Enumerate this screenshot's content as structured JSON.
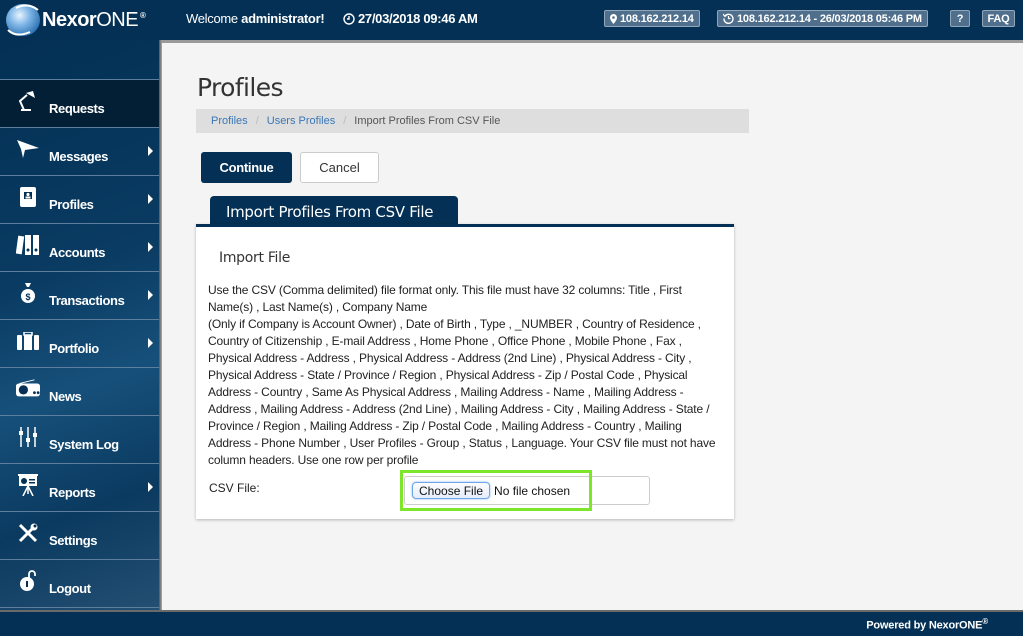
{
  "header": {
    "brand_bold": "Nexor",
    "brand_thin": "ONE",
    "brand_mark": "®",
    "welcome_prefix": "Welcome ",
    "welcome_user": "administrator!",
    "current_datetime": "27/03/2018 09:46 AM",
    "ip_address": "108.162.212.14",
    "last_login": "108.162.212.14 - 26/03/2018 05:46 PM",
    "help_label": "?",
    "faq_label": "FAQ"
  },
  "sidebar": {
    "items": [
      {
        "label": "Requests",
        "icon": "desk-lamp-icon",
        "active": true,
        "has_submenu": false
      },
      {
        "label": "Messages",
        "icon": "paper-plane-icon",
        "active": false,
        "has_submenu": true
      },
      {
        "label": "Profiles",
        "icon": "address-book-icon",
        "active": false,
        "has_submenu": true
      },
      {
        "label": "Accounts",
        "icon": "binders-icon",
        "active": false,
        "has_submenu": true
      },
      {
        "label": "Transactions",
        "icon": "money-bag-icon",
        "active": false,
        "has_submenu": true
      },
      {
        "label": "Portfolio",
        "icon": "briefcase-icon",
        "active": false,
        "has_submenu": true
      },
      {
        "label": "News",
        "icon": "radio-icon",
        "active": false,
        "has_submenu": false
      },
      {
        "label": "System Log",
        "icon": "sliders-icon",
        "active": false,
        "has_submenu": false
      },
      {
        "label": "Reports",
        "icon": "presentation-board-icon",
        "active": false,
        "has_submenu": true
      },
      {
        "label": "Settings",
        "icon": "tools-icon",
        "active": false,
        "has_submenu": false
      },
      {
        "label": "Logout",
        "icon": "unlocked-padlock-icon",
        "active": false,
        "has_submenu": false
      }
    ]
  },
  "main": {
    "page_title": "Profiles",
    "breadcrumb": [
      {
        "label": "Profiles",
        "link": true
      },
      {
        "label": "Users Profiles",
        "link": true
      },
      {
        "label": "Import Profiles From CSV File",
        "link": false
      }
    ],
    "continue_label": "Continue",
    "cancel_label": "Cancel",
    "panel_tab": "Import Profiles From CSV File",
    "panel_heading": "Import File",
    "description_line1": "Use the CSV (Comma delimited) file format only. This file must have 32 columns: Title , First Name(s) , Last Name(s) , Company Name",
    "description_line2": "(Only if Company is Account Owner) , Date of Birth , Type , _NUMBER , Country of Residence , Country of Citizenship , E-mail Address , Home Phone , Office Phone , Mobile Phone , Fax , Physical Address - Address , Physical Address - Address (2nd Line) , Physical Address - City , Physical Address - State / Province / Region , Physical Address - Zip / Postal Code , Physical Address - Country , Same As Physical Address , Mailing Address - Name , Mailing Address - Address , Mailing Address - Address (2nd Line) , Mailing Address - City , Mailing Address - State / Province / Region , Mailing Address - Zip / Postal Code , Mailing Address - Country , Mailing Address - Phone Number , User Profiles - Group , Status , Language. Your CSV file must not have column headers. Use one row per profile",
    "csv_label": "CSV File:",
    "choose_file_label": "Choose File",
    "no_file_text": "No file chosen"
  },
  "footer": {
    "powered_by": "Powered by NexorONE",
    "mark": "®"
  },
  "colors": {
    "brand_navy": "#033054",
    "highlight_green": "#7ee62a",
    "link_blue": "#3b77b5"
  }
}
